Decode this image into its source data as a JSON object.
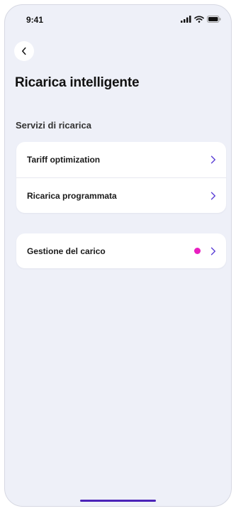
{
  "status_bar": {
    "time": "9:41",
    "icons": [
      "signal-icon",
      "wifi-icon",
      "battery-icon"
    ]
  },
  "header": {
    "back_icon": "chevron-left-icon",
    "title": "Ricarica intelligente"
  },
  "section": {
    "title": "Servizi di ricarica"
  },
  "services": [
    {
      "label": "Tariff optimization",
      "icon": "chevron-right-icon"
    },
    {
      "label": "Ricarica programmata",
      "icon": "chevron-right-icon"
    }
  ],
  "load_management": {
    "label": "Gestione del carico",
    "indicator": "notification-dot",
    "icon": "chevron-right-icon"
  },
  "colors": {
    "background": "#eef0f8",
    "card": "#ffffff",
    "accent": "#5b3fd6",
    "notification_dot": "#e91ec0",
    "home_indicator": "#4b23b8"
  }
}
